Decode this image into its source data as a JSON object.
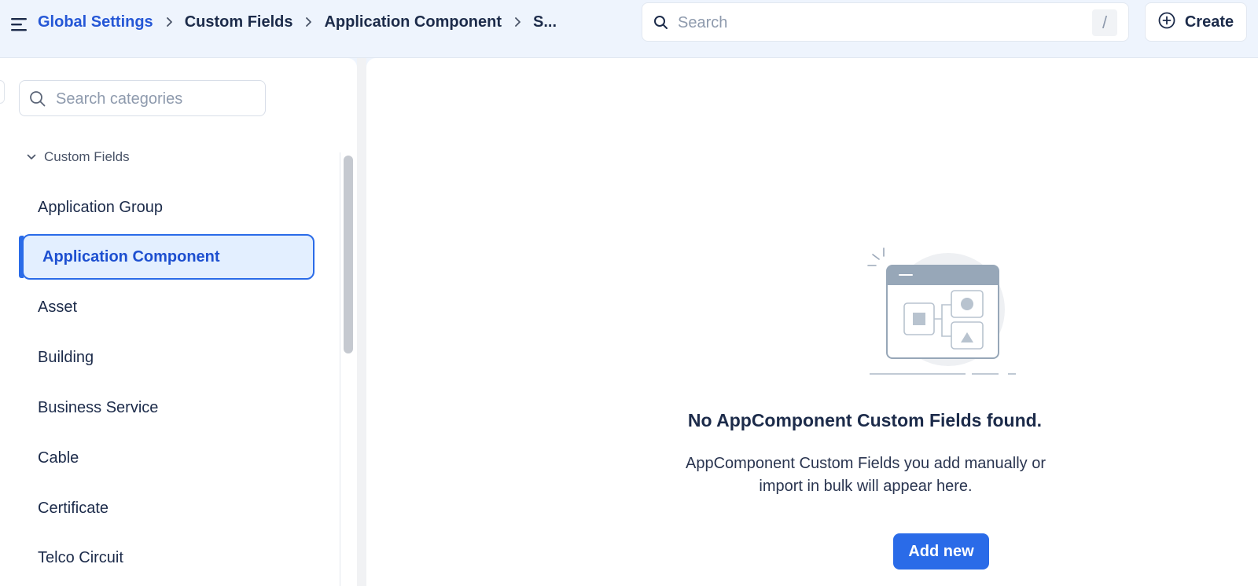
{
  "header": {
    "breadcrumb": [
      "Global Settings",
      "Custom Fields",
      "Application Component",
      "S..."
    ],
    "search_placeholder": "Search",
    "search_shortcut": "/",
    "create_label": "Create"
  },
  "sidebar": {
    "search_placeholder": "Search categories",
    "group_label": "Custom Fields",
    "items": [
      {
        "label": "Application Group",
        "active": false
      },
      {
        "label": "Application Component",
        "active": true
      },
      {
        "label": "Asset",
        "active": false
      },
      {
        "label": "Building",
        "active": false
      },
      {
        "label": "Business Service",
        "active": false
      },
      {
        "label": "Cable",
        "active": false
      },
      {
        "label": "Certificate",
        "active": false
      },
      {
        "label": "Telco Circuit",
        "active": false
      }
    ]
  },
  "main": {
    "empty_title": "No AppComponent Custom Fields found.",
    "empty_description": "AppComponent Custom Fields you add manually or import in bulk will appear here.",
    "add_button_label": "Add new"
  },
  "colors": {
    "accent": "#2a6be8",
    "breadcrumb_link": "#2557d6",
    "active_bg": "#e3efff",
    "header_bg": "#eef4fd"
  },
  "icons": {
    "menu": "hamburger-menu-icon",
    "search": "search-icon",
    "create": "plus-circle-icon",
    "chevron": "chevron-right-icon",
    "group_toggle": "chevron-down-icon",
    "empty_state": "empty-state-illustration"
  }
}
